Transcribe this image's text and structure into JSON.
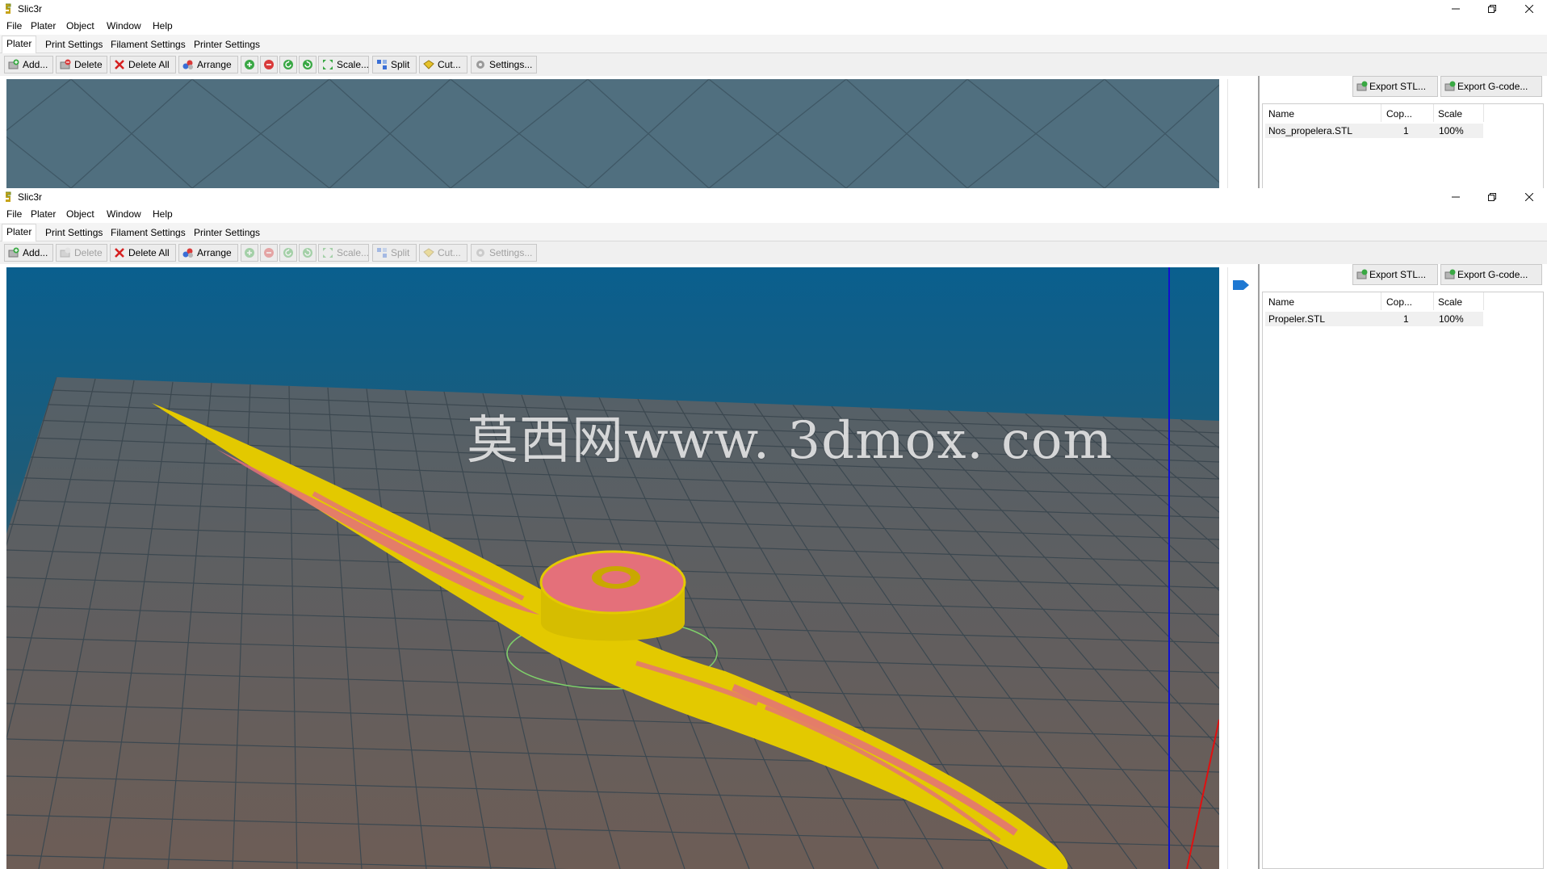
{
  "windows": [
    {
      "title": "Slic3r",
      "menu": [
        "File",
        "Plater",
        "Object",
        "Window",
        "Help"
      ],
      "tabs": [
        "Plater",
        "Print Settings",
        "Filament Settings",
        "Printer Settings"
      ],
      "toolbar": {
        "add": "Add...",
        "delete": "Delete",
        "delete_all": "Delete All",
        "arrange": "Arrange",
        "scale": "Scale...",
        "split": "Split",
        "cut": "Cut...",
        "settings": "Settings..."
      },
      "toolbar_state": "object-selected",
      "export_stl": "Export STL...",
      "export_gcode": "Export G-code...",
      "object_list": {
        "headers": [
          "Name",
          "Cop...",
          "Scale"
        ],
        "rows": [
          {
            "name": "Nos_propelera.STL",
            "copies": "1",
            "scale": "100%"
          }
        ]
      }
    },
    {
      "title": "Slic3r",
      "menu": [
        "File",
        "Plater",
        "Object",
        "Window",
        "Help"
      ],
      "tabs": [
        "Plater",
        "Print Settings",
        "Filament Settings",
        "Printer Settings"
      ],
      "toolbar": {
        "add": "Add...",
        "delete": "Delete",
        "delete_all": "Delete All",
        "arrange": "Arrange",
        "scale": "Scale...",
        "split": "Split",
        "cut": "Cut...",
        "settings": "Settings..."
      },
      "toolbar_state": "no-selection",
      "export_stl": "Export STL...",
      "export_gcode": "Export G-code...",
      "object_list": {
        "headers": [
          "Name",
          "Cop...",
          "Scale"
        ],
        "rows": [
          {
            "name": "Propeler.STL",
            "copies": "1",
            "scale": "100%"
          }
        ]
      }
    }
  ],
  "watermark": "莫西网www. 3dmox. com",
  "colors": {
    "viewport_flat": "#4f6e7e",
    "viewport_sky_top": "#0a5f8e",
    "viewport_bottom": "#6b5248",
    "model_yellow": "#e8d000",
    "model_pink": "#e4707a",
    "axis_blue": "#1010d0",
    "axis_red": "#e01010",
    "bed_circle": "#7fd06a"
  },
  "icons": {
    "app": "slic3r-logo-icon",
    "add": "add-brick-icon",
    "delete": "delete-brick-icon",
    "delete_all": "red-x-icon",
    "arrange": "arrange-icon",
    "increase": "plus-circle-icon",
    "decrease": "minus-circle-icon",
    "rotate_ccw": "rotate-left-icon",
    "rotate_cw": "rotate-right-icon",
    "scale": "scale-arrows-icon",
    "split": "split-icon",
    "cut": "cut-icon",
    "settings": "settings-cog-icon",
    "export": "export-brick-icon"
  }
}
